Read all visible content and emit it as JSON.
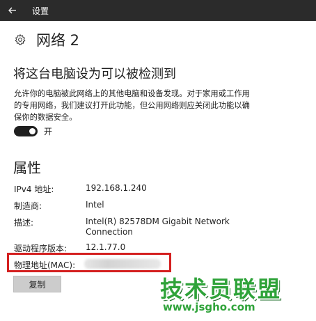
{
  "titlebar": {
    "title": "设置"
  },
  "header": {
    "title": "网络 2"
  },
  "discoverable": {
    "heading": "将这台电脑设为可以被检测到",
    "description": "允许你的电脑被此网络上的其他电脑和设备发现。对于家用或工作用的专用网络，我们建议打开此功能，但公用网络则应关闭此功能以确保你的数据安全。",
    "toggle_label": "开"
  },
  "properties": {
    "heading": "属性",
    "ipv4_label": "IPv4 地址:",
    "ipv4_value": "192.168.1.240",
    "manufacturer_label": "制造商:",
    "manufacturer_value": "Intel",
    "description_label": "描述:",
    "description_line1": "Intel(R) 82578DM Gigabit Network",
    "description_line2": "Connection",
    "driver_label": "驱动程序版本:",
    "driver_value": "12.1.77.0",
    "mac_label": "物理地址(MAC):",
    "copy_button": "复制"
  },
  "watermark": {
    "text": "技术员联盟",
    "url": "www.jsgho.com"
  },
  "colors": {
    "titlebar_bg": "#2b2b2b",
    "highlight": "#d42020",
    "watermark_green": "#2fa33a"
  }
}
